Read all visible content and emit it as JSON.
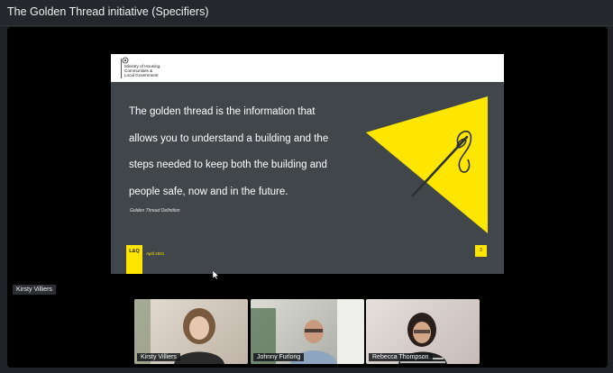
{
  "window": {
    "title": "The Golden Thread initiative (Specifiers)"
  },
  "slide": {
    "ministry_lines": [
      "Ministry of Housing,",
      "Communities &",
      "Local Government"
    ],
    "quote_lines": [
      "The golden thread is the information that",
      "allows you to understand a building and the",
      "steps needed to keep both the building and",
      "people safe, now and in the future."
    ],
    "caption": "Golden Thread Definition",
    "logo_text": "L&Q",
    "date": "April 2021",
    "page_number": "3",
    "accent_color": "#ffe600",
    "background_color": "#404649"
  },
  "active_speaker": {
    "label": "Kirsty Villiers"
  },
  "participants": [
    {
      "name": "Kirsty Villiers"
    },
    {
      "name": "Johnny Furlong"
    },
    {
      "name": "Rebecca Thompson"
    }
  ]
}
